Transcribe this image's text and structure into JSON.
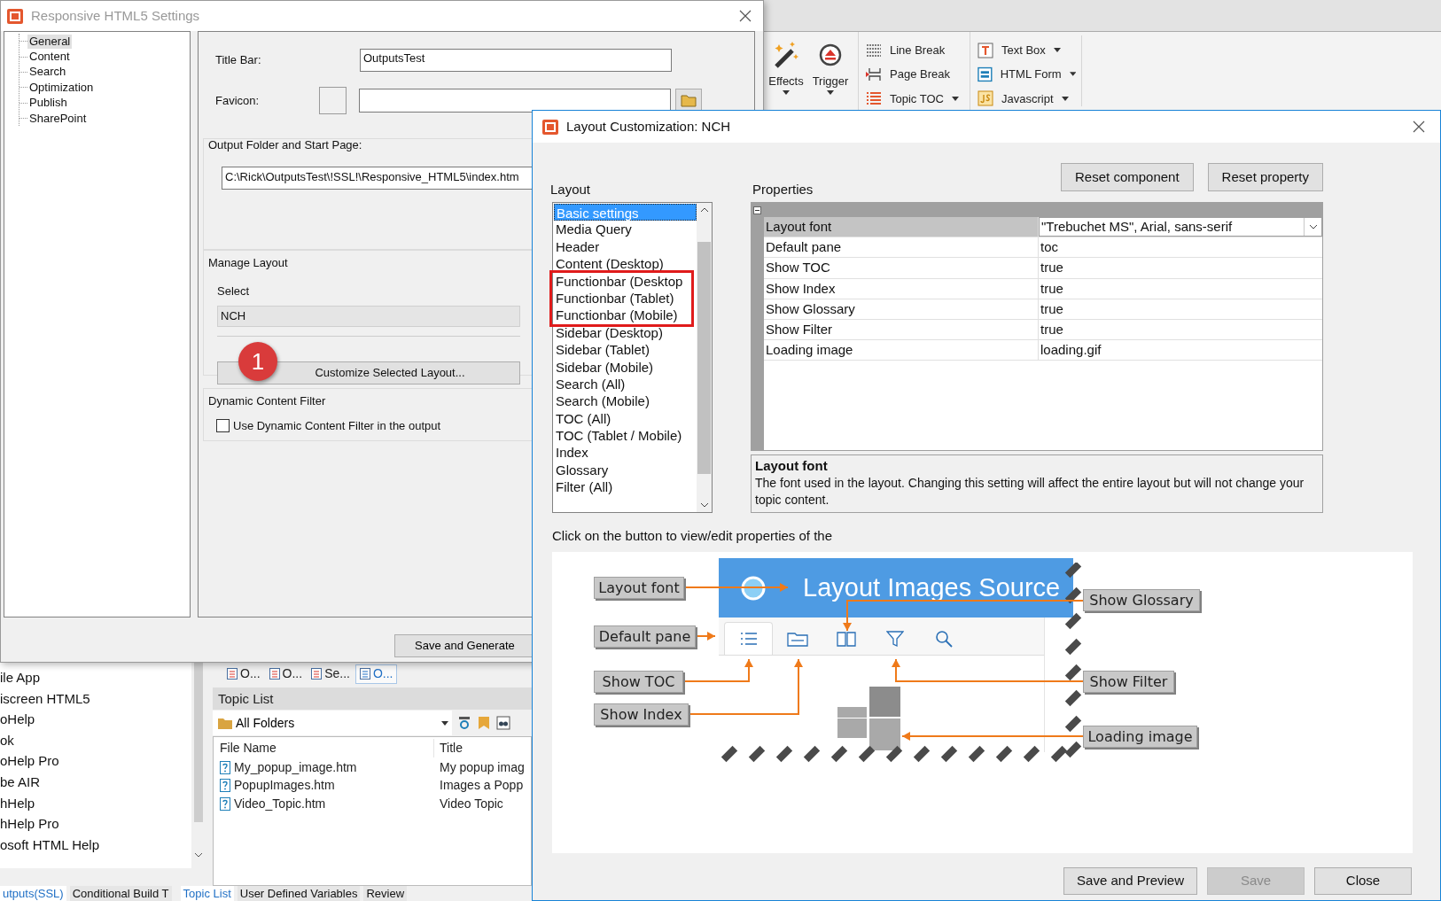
{
  "ribbon": {
    "large": [
      {
        "label": "Effects",
        "dropdown": true
      },
      {
        "label": "Trigger",
        "dropdown": true
      }
    ],
    "columns": [
      [
        {
          "label": "Line Break",
          "dropdown": false
        },
        {
          "label": "Page Break",
          "dropdown": false
        },
        {
          "label": "Topic TOC",
          "dropdown": true
        }
      ],
      [
        {
          "label": "Text Box",
          "dropdown": true
        },
        {
          "label": "HTML Form",
          "dropdown": true
        },
        {
          "label": "Javascript",
          "dropdown": true
        }
      ]
    ]
  },
  "background_app": {
    "left_list": [
      "ile App",
      "iscreen HTML5",
      "oHelp",
      "ok",
      "oHelp Pro",
      "be AIR",
      "hHelp",
      "hHelp Pro",
      "osoft HTML Help"
    ],
    "pane_tabs": [
      {
        "label": "O...",
        "selected": false
      },
      {
        "label": "O...",
        "selected": false
      },
      {
        "label": "Se...",
        "selected": false
      },
      {
        "label": "O...",
        "selected": true
      }
    ],
    "topic_list": {
      "title": "Topic List",
      "folder": "All Folders",
      "columns": [
        "File Name",
        "Title"
      ],
      "rows": [
        [
          "My_popup_image.htm",
          "My popup imag"
        ],
        [
          "PopupImages.htm",
          "Images a Popp"
        ],
        [
          "Video_Topic.htm",
          "Video Topic"
        ]
      ]
    },
    "bottom_tabs_left": [
      {
        "label": "utputs(SSL)",
        "selected": true
      },
      {
        "label": "Conditional Build T",
        "selected": false
      }
    ],
    "bottom_tabs_right": [
      {
        "label": "Topic List",
        "selected": true
      },
      {
        "label": "User Defined Variables",
        "selected": false
      },
      {
        "label": "Review",
        "selected": false
      }
    ]
  },
  "settings_dialog": {
    "title": "Responsive HTML5 Settings",
    "tree": [
      {
        "label": "General",
        "selected": true
      },
      {
        "label": "Content",
        "selected": false
      },
      {
        "label": "Search",
        "selected": false
      },
      {
        "label": "Optimization",
        "selected": false
      },
      {
        "label": "Publish",
        "selected": false
      },
      {
        "label": "SharePoint",
        "selected": false
      }
    ],
    "title_bar": {
      "label": "Title Bar:",
      "value": "OutputsTest"
    },
    "favicon": {
      "label": "Favicon:"
    },
    "output_folder": {
      "label": "Output Folder and Start Page:",
      "value": "C:\\Rick\\OutputsTest\\!SSL!\\Responsive_HTML5\\index.htm"
    },
    "manage_layout": {
      "label": "Manage Layout",
      "select_label": "Select",
      "value": "NCH",
      "button": "Customize Selected Layout...",
      "badge": "1"
    },
    "dynamic_filter": {
      "label": "Dynamic Content Filter",
      "checkbox_label": "Use Dynamic Content Filter in the output",
      "checked": false
    },
    "save_button": "Save and Generate"
  },
  "layout_dialog": {
    "title": "Layout Customization: NCH",
    "layout_label": "Layout",
    "layout_items": [
      {
        "label": "Basic settings",
        "selected": true,
        "highlighted": false
      },
      {
        "label": "Media Query",
        "selected": false,
        "highlighted": false
      },
      {
        "label": "Header",
        "selected": false,
        "highlighted": false
      },
      {
        "label": "Content (Desktop)",
        "selected": false,
        "highlighted": false
      },
      {
        "label": "Functionbar (Desktop",
        "selected": false,
        "highlighted": true
      },
      {
        "label": "Functionbar (Tablet)",
        "selected": false,
        "highlighted": true
      },
      {
        "label": "Functionbar (Mobile)",
        "selected": false,
        "highlighted": true
      },
      {
        "label": "Sidebar (Desktop)",
        "selected": false,
        "highlighted": false
      },
      {
        "label": "Sidebar (Tablet)",
        "selected": false,
        "highlighted": false
      },
      {
        "label": "Sidebar (Mobile)",
        "selected": false,
        "highlighted": false
      },
      {
        "label": "Search (All)",
        "selected": false,
        "highlighted": false
      },
      {
        "label": "Search (Mobile)",
        "selected": false,
        "highlighted": false
      },
      {
        "label": "TOC (All)",
        "selected": false,
        "highlighted": false
      },
      {
        "label": "TOC (Tablet / Mobile)",
        "selected": false,
        "highlighted": false
      },
      {
        "label": "Index",
        "selected": false,
        "highlighted": false
      },
      {
        "label": "Glossary",
        "selected": false,
        "highlighted": false
      },
      {
        "label": "Filter (All)",
        "selected": false,
        "highlighted": false
      }
    ],
    "properties_label": "Properties",
    "reset_buttons": [
      "Reset component",
      "Reset property"
    ],
    "properties": [
      {
        "name": "Layout font",
        "value": "\"Trebuchet MS\", Arial, sans-serif",
        "selected": true,
        "kind": "dropdown"
      },
      {
        "name": "Default pane",
        "value": "toc",
        "selected": false,
        "kind": "text"
      },
      {
        "name": "Show TOC",
        "value": "true",
        "selected": false,
        "kind": "text"
      },
      {
        "name": "Show Index",
        "value": "true",
        "selected": false,
        "kind": "text"
      },
      {
        "name": "Show Glossary",
        "value": "true",
        "selected": false,
        "kind": "text"
      },
      {
        "name": "Show Filter",
        "value": "true",
        "selected": false,
        "kind": "text"
      },
      {
        "name": "Loading image",
        "value": "loading.gif",
        "selected": false,
        "kind": "text"
      }
    ],
    "description": {
      "title": "Layout font",
      "text": "The font used in the layout. Changing this setting will affect the entire layout but will not change your topic content."
    },
    "hint": "Click on the button to view/edit properties of the",
    "preview": {
      "title": "Layout Images Source",
      "callouts": [
        "Layout font",
        "Default pane",
        "Show TOC",
        "Show Index",
        "Show Glossary",
        "Show Filter",
        "Loading image"
      ]
    },
    "footer_buttons": [
      {
        "label": "Save and Preview",
        "disabled": false
      },
      {
        "label": "Save",
        "disabled": true
      },
      {
        "label": "Close",
        "disabled": false
      }
    ]
  }
}
